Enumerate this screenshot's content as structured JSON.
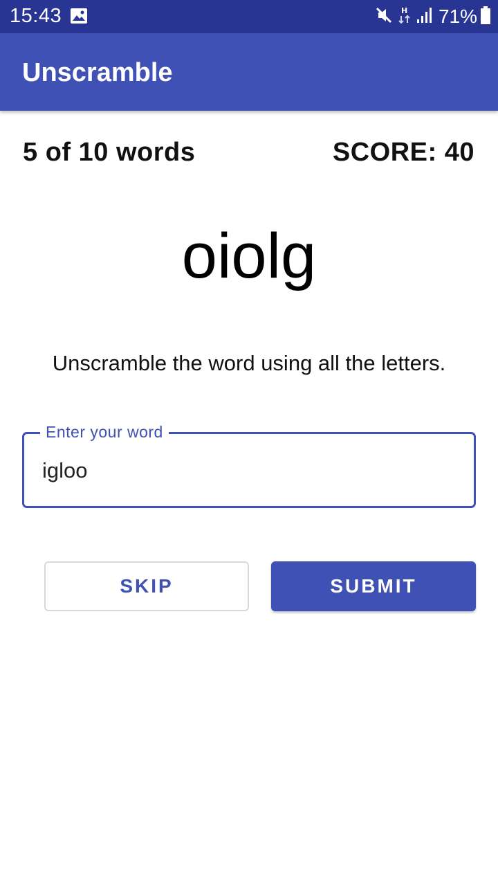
{
  "status_bar": {
    "time": "15:43",
    "battery": "71%",
    "icons": [
      "gallery-icon",
      "mute-icon",
      "hplus-data-icon",
      "signal-icon",
      "battery-icon"
    ]
  },
  "app_bar": {
    "title": "Unscramble"
  },
  "game": {
    "word_count": "5 of 10 words",
    "score": "SCORE: 40",
    "scrambled_word": "oiolg",
    "instructions": "Unscramble the word using all the letters."
  },
  "input": {
    "label": "Enter your word",
    "value": "igloo"
  },
  "buttons": {
    "skip": "SKIP",
    "submit": "SUBMIT"
  },
  "colors": {
    "status_bar": "#283593",
    "primary": "#3f51b5"
  }
}
